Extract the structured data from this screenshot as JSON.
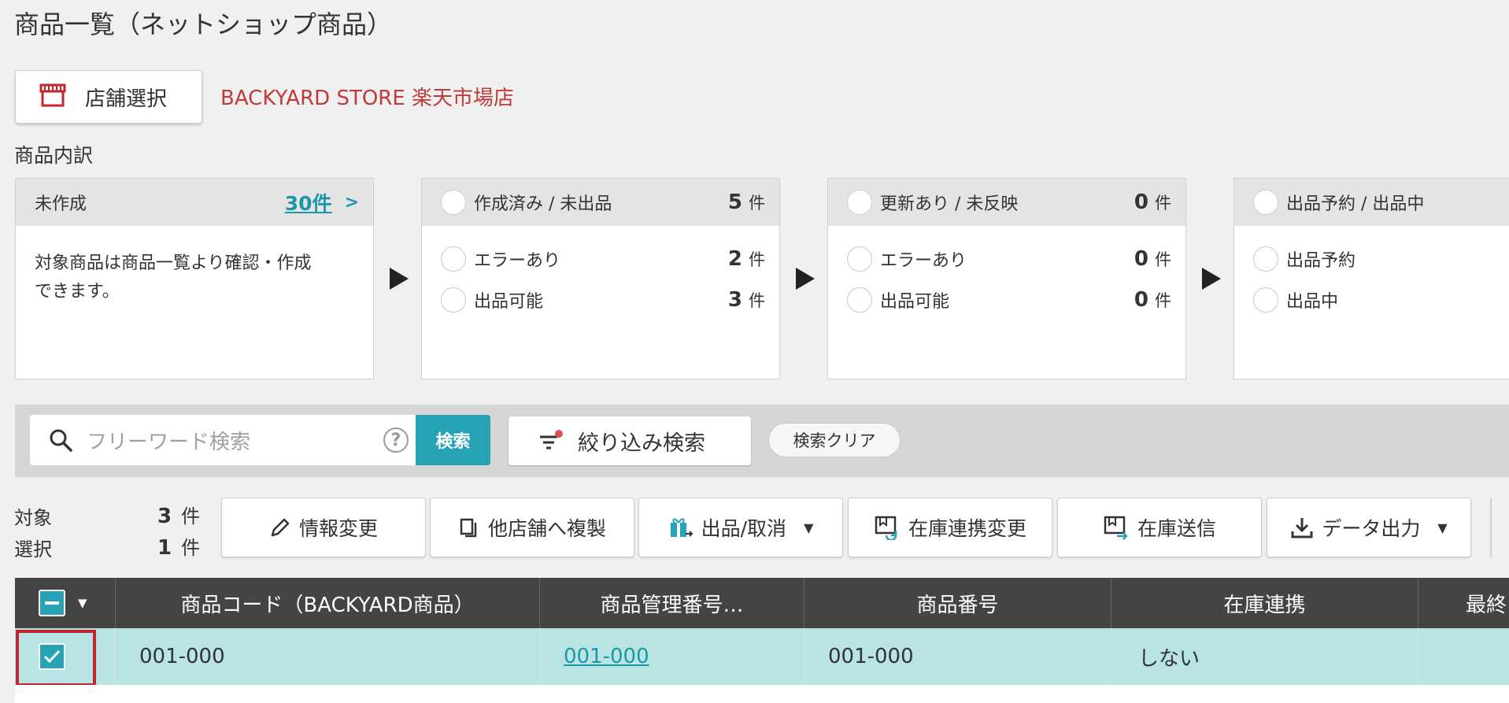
{
  "title": "商品一覧（ネットショップ商品）",
  "store": {
    "button_label": "店舗選択",
    "name": "BACKYARD STORE 楽天市場店"
  },
  "breakdown_label": "商品内訳",
  "cards": {
    "uncreated": {
      "label": "未作成",
      "count_link": "30件",
      "desc_line1": "対象商品は商品一覧より確認・作成",
      "desc_line2": "できます。"
    },
    "created": {
      "label": "作成済み / 未出品",
      "count": "5",
      "unit": "件",
      "rows": [
        {
          "label": "エラーあり",
          "count": "2",
          "unit": "件"
        },
        {
          "label": "出品可能",
          "count": "3",
          "unit": "件"
        }
      ]
    },
    "updated": {
      "label": "更新あり / 未反映",
      "count": "0",
      "unit": "件",
      "rows": [
        {
          "label": "エラーあり",
          "count": "0",
          "unit": "件"
        },
        {
          "label": "出品可能",
          "count": "0",
          "unit": "件"
        }
      ]
    },
    "listing": {
      "label": "出品予約 / 出品中",
      "rows": [
        {
          "label": "出品予約"
        },
        {
          "label": "出品中"
        }
      ]
    }
  },
  "search": {
    "placeholder": "フリーワード検索",
    "help": "?",
    "button": "検索",
    "filter_button": "絞り込み検索",
    "clear_button": "検索クリア"
  },
  "counts": {
    "target_label": "対象",
    "target_value": "3",
    "selected_label": "選択",
    "selected_value": "1",
    "unit": "件"
  },
  "actions": {
    "edit": "情報変更",
    "copy": "他店舗へ複製",
    "list_cancel": "出品/取消",
    "stock_link_change": "在庫連携変更",
    "stock_send": "在庫送信",
    "export": "データ出力"
  },
  "table": {
    "headers": [
      "商品コード（BACKYARD商品）",
      "商品管理番号…",
      "商品番号",
      "在庫連携",
      "最終"
    ],
    "rows": [
      {
        "code": "001-000",
        "manage_no": "001-000",
        "item_no": "001-000",
        "stock_link": "しない",
        "checked": true
      }
    ]
  },
  "colors": {
    "accent": "#26a3b4",
    "store_name": "#c03a3a",
    "highlight": "#c0262d",
    "row_selected": "#b8e4e4"
  }
}
